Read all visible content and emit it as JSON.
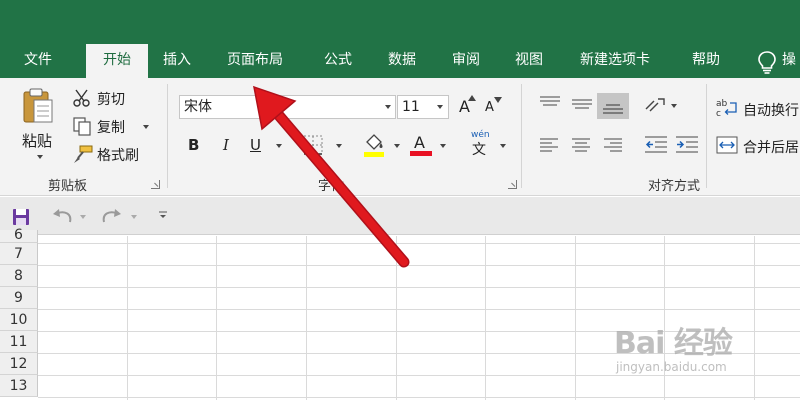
{
  "tabs": [
    {
      "label": "文件"
    },
    {
      "label": "开始"
    },
    {
      "label": "插入"
    },
    {
      "label": "页面布局"
    },
    {
      "label": "公式"
    },
    {
      "label": "数据"
    },
    {
      "label": "审阅"
    },
    {
      "label": "视图"
    },
    {
      "label": "新建选项卡"
    },
    {
      "label": "帮助"
    },
    {
      "label": "操"
    }
  ],
  "help_icon": "lightbulb-icon",
  "clipboard": {
    "paste_label": "粘贴",
    "cut_label": "剪切",
    "copy_label": "复制",
    "format_painter_label": "格式刷",
    "group_label": "剪贴板"
  },
  "font": {
    "font_name": "宋体",
    "font_size": "11",
    "grow_label": "A",
    "shrink_label": "A",
    "bold_label": "B",
    "italic_label": "I",
    "underline_label": "U",
    "font_color_label": "A",
    "phonetic_top": "wén",
    "phonetic_char": "文",
    "group_label": "字体",
    "font_color": "#e81123",
    "fill_color": "#ffff00"
  },
  "alignment": {
    "wrap_text_label": "自动换行",
    "merge_label": "合并后居",
    "group_label": "对齐方式"
  },
  "qat": {
    "save_icon": "save-icon",
    "undo_icon": "undo-icon",
    "redo_icon": "redo-icon",
    "customize_icon": "customize-qat-icon"
  },
  "grid": {
    "rows": [
      "6",
      "7",
      "8",
      "9",
      "10",
      "11",
      "12",
      "13"
    ]
  },
  "watermark": {
    "brand": "Bai 经验",
    "sub": "jingyan.baidu.com"
  },
  "colors": {
    "accent": "#217346",
    "ribbon_bg": "#f3f3f3",
    "arrow": "#e0191e"
  }
}
